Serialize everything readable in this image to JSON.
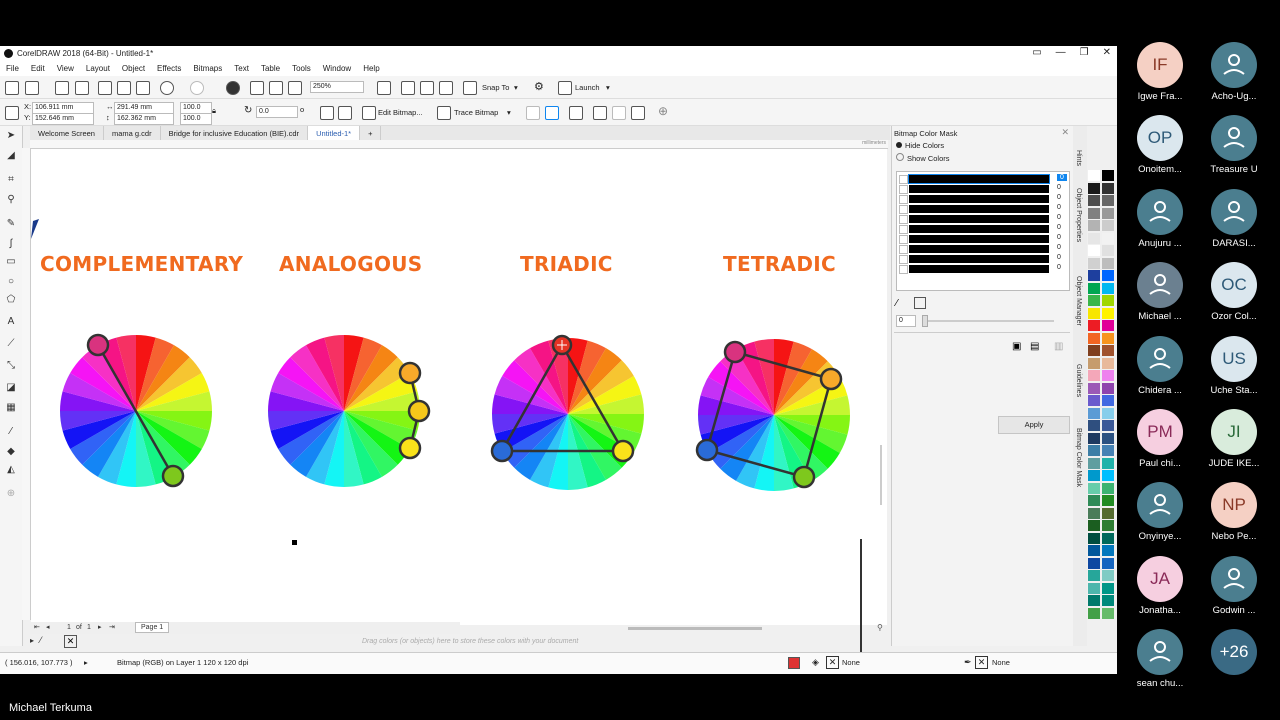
{
  "window": {
    "title": "CorelDRAW 2018 (64-Bit) - Untitled-1*"
  },
  "menu": [
    "File",
    "Edit",
    "View",
    "Layout",
    "Object",
    "Effects",
    "Bitmaps",
    "Text",
    "Table",
    "Tools",
    "Window",
    "Help"
  ],
  "toolbar1": {
    "zoom": "250%",
    "snap_to": "Snap To",
    "launch": "Launch"
  },
  "toolbar2": {
    "x": "106.911 mm",
    "y": "152.646 mm",
    "w": "291.49 mm",
    "h": "162.362 mm",
    "sx": "100.0",
    "sy": "100.0",
    "rotation": "0.0",
    "edit_bitmap": "Edit Bitmap...",
    "trace_bitmap": "Trace Bitmap"
  },
  "tabs": [
    "Welcome Screen",
    "mama g.cdr",
    "Bridge for inclusive Education (BIE).cdr",
    "Untitled-1*"
  ],
  "canvas": {
    "headings": [
      "COMPLEMENTARY",
      "ANALOGOUS",
      "TRIADIC",
      "TETRADIC"
    ],
    "ruler_unit": "millimeters"
  },
  "pagebar": {
    "page_num": "1",
    "of": "of",
    "total": "1",
    "page_tab": "Page 1"
  },
  "hint": "Drag colors (or objects) here to store these colors with your document",
  "status": {
    "coords": "( 156.016, 107.773 )",
    "info": "Bitmap (RGB) on Layer 1 120 x 120 dpi",
    "fill": "None",
    "outline": "None"
  },
  "panel": {
    "title": "Bitmap Color Mask",
    "hide_colors": "Hide Colors",
    "show_colors": "Show Colors",
    "tolerance": "0",
    "apply": "Apply",
    "rows": [
      "0",
      "0",
      "0",
      "0",
      "0",
      "0",
      "0",
      "0",
      "0",
      "0"
    ]
  },
  "docker_tabs": [
    "Hints",
    "Object Properties",
    "Object Manager",
    "Guidelines",
    "Bitmap Color Mask"
  ],
  "participants": [
    {
      "initials": "IF",
      "name": "Igwe Fra...",
      "bg": "#f5d0c4",
      "fg": "#8a3a28"
    },
    {
      "initials": "",
      "name": "Acho-Ug...",
      "bg": "#4b7e8f",
      "fg": "#fff"
    },
    {
      "initials": "OP",
      "name": "Onoitem...",
      "bg": "#dbe7ee",
      "fg": "#2e5a78"
    },
    {
      "initials": "",
      "name": "Treasure U",
      "bg": "#4b7e8f",
      "fg": "#fff"
    },
    {
      "initials": "",
      "name": "Anujuru ...",
      "bg": "#4b7e8f",
      "fg": "#fff"
    },
    {
      "initials": "",
      "name": "DARASI...",
      "bg": "#4b7e8f",
      "fg": "#fff"
    },
    {
      "initials": "",
      "name": "Michael ...",
      "bg": "#6b8090",
      "fg": "#fff"
    },
    {
      "initials": "OC",
      "name": "Ozor Col...",
      "bg": "#dbe7ee",
      "fg": "#2e5a78"
    },
    {
      "initials": "",
      "name": "Chidera ...",
      "bg": "#4b7e8f",
      "fg": "#fff"
    },
    {
      "initials": "US",
      "name": "Uche Sta...",
      "bg": "#dbe7ee",
      "fg": "#2e5a78"
    },
    {
      "initials": "PM",
      "name": "Paul chi...",
      "bg": "#f6cfe0",
      "fg": "#8a2a58"
    },
    {
      "initials": "JI",
      "name": "JUDE IKE...",
      "bg": "#d9ecdc",
      "fg": "#2a6a3a"
    },
    {
      "initials": "",
      "name": "Onyinye...",
      "bg": "#4b7e8f",
      "fg": "#fff"
    },
    {
      "initials": "NP",
      "name": "Nebo Pe...",
      "bg": "#f5d0c4",
      "fg": "#8a3a28"
    },
    {
      "initials": "JA",
      "name": "Jonatha...",
      "bg": "#f6cfe0",
      "fg": "#8a2a58"
    },
    {
      "initials": "",
      "name": "Godwin ...",
      "bg": "#4b7e8f",
      "fg": "#fff"
    },
    {
      "initials": "",
      "name": "sean chu...",
      "bg": "#4b7e8f",
      "fg": "#fff"
    },
    {
      "initials": "+26",
      "name": "",
      "bg": "#3a6a84",
      "fg": "#fff"
    }
  ],
  "speaker": "Michael Terkuma",
  "colors": {
    "accent": "#f06a1f",
    "select_blue": "#0f86ef"
  }
}
